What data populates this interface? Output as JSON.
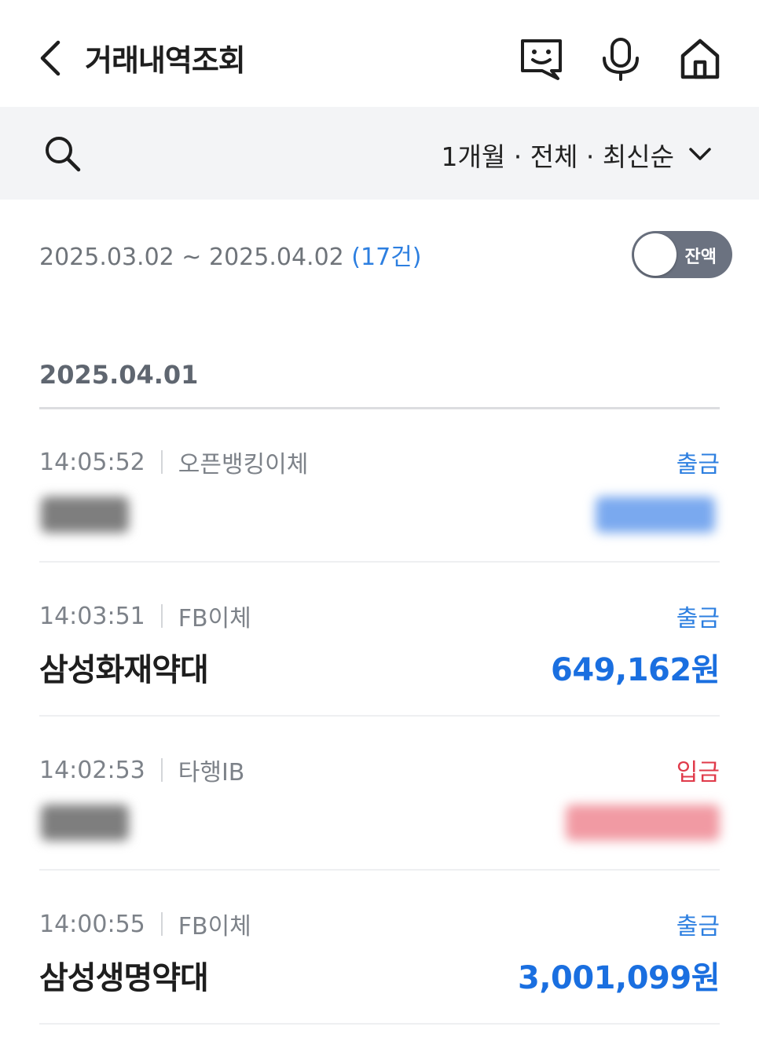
{
  "header": {
    "title": "거래내역조회",
    "icons": [
      "chevron-left-icon",
      "chatbot-icon",
      "microphone-icon",
      "home-icon"
    ]
  },
  "filter": {
    "summary": "1개월 · 전체 · 최신순",
    "icons": [
      "search-icon",
      "chevron-down-icon"
    ]
  },
  "period": {
    "range": "2025.03.02 ~ 2025.04.02",
    "count": "(17건)"
  },
  "balance_toggle": {
    "label": "잔액",
    "on": false
  },
  "date_group": {
    "date": "2025.04.01"
  },
  "transactions": [
    {
      "time": "14:05:52",
      "channel": "오픈뱅킹이체",
      "kind": "출금",
      "direction": "out",
      "hidden": true
    },
    {
      "time": "14:03:51",
      "channel": "FB이체",
      "kind": "출금",
      "direction": "out",
      "name": "삼성화재약대",
      "amount": "649,162원"
    },
    {
      "time": "14:02:53",
      "channel": "타행IB",
      "kind": "입금",
      "direction": "in",
      "hidden": true
    },
    {
      "time": "14:00:55",
      "channel": "FB이체",
      "kind": "출금",
      "direction": "out",
      "name": "삼성생명약대",
      "amount": "3,001,099원"
    }
  ],
  "colors": {
    "outgoing": "#1a6fe0",
    "incoming": "#e03a4a",
    "filter_bg": "#f3f4f6",
    "toggle_bg": "#6b7280"
  }
}
